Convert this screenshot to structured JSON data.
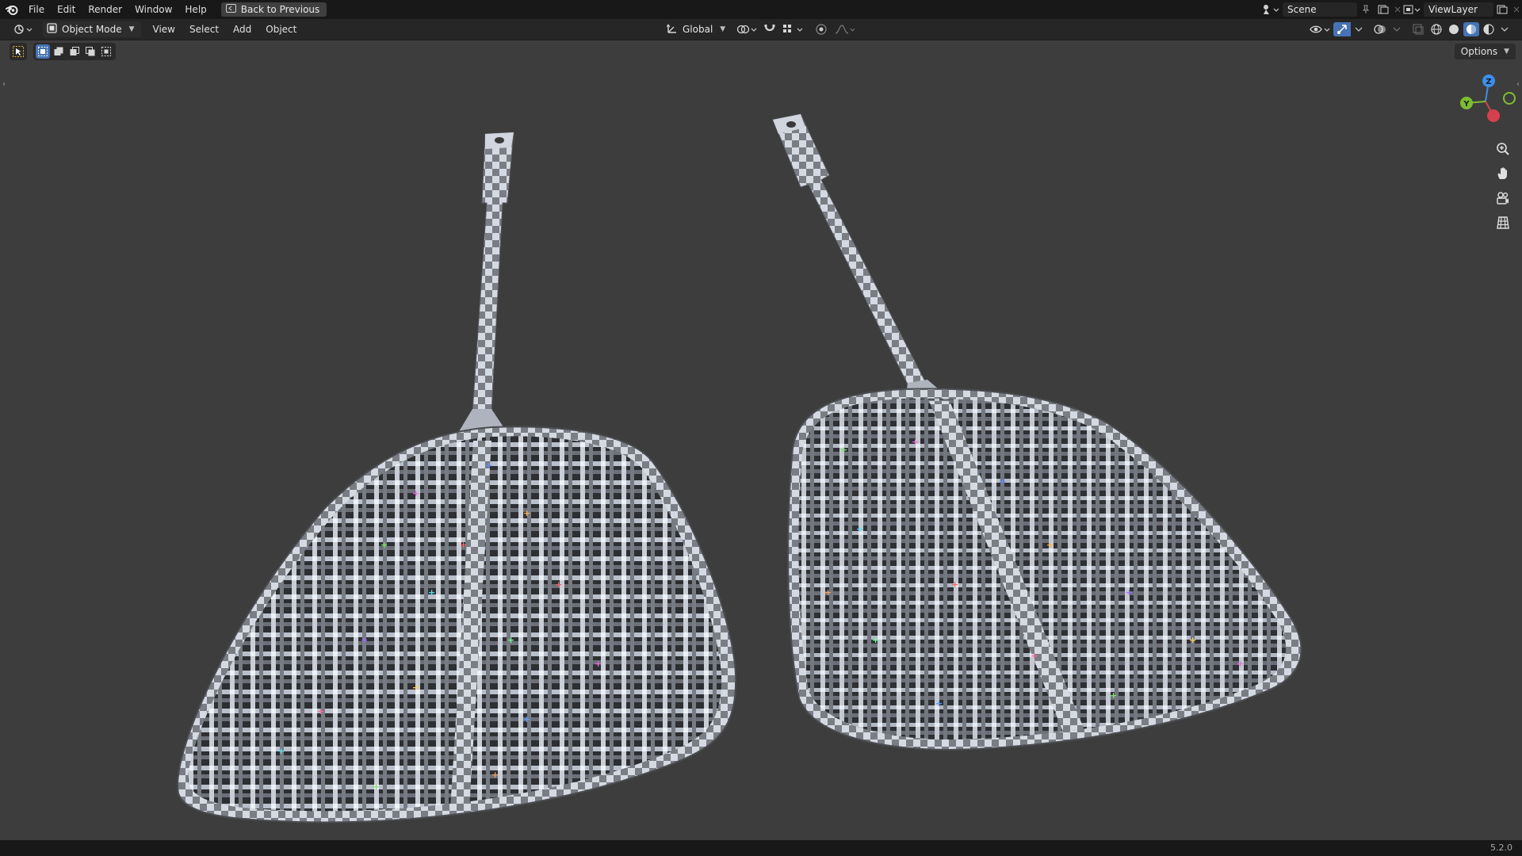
{
  "topbar": {
    "menu": [
      "File",
      "Edit",
      "Render",
      "Window",
      "Help"
    ],
    "back_label": "Back to Previous",
    "scene_label": "Scene",
    "viewlayer_label": "ViewLayer"
  },
  "header": {
    "mode_label": "Object Mode",
    "menus": [
      "View",
      "Select",
      "Add",
      "Object"
    ],
    "transform_orientation": "Global"
  },
  "tool_row": {
    "options_label": "Options"
  },
  "gizmo": {
    "z_label": "Z",
    "y_label": "Y",
    "x_color": "#d6404e",
    "y_color": "#7ebd2f",
    "z_color": "#3d8fe6"
  },
  "statusbar": {
    "version": "5.2.0"
  },
  "colors": {
    "topbar_bg": "#181818",
    "header_bg": "#262626",
    "viewport_bg": "#3d3d3d",
    "accent_blue": "#4772b3"
  },
  "icons": [
    "blender-logo-icon",
    "back-icon",
    "scene-icon",
    "pin-icon",
    "new-scene-icon",
    "viewlayer-icon",
    "editor-type-icon",
    "object-mode-icon",
    "transform-orientation-icon",
    "pivot-icon",
    "snap-icon",
    "proportional-edit-icon",
    "visibility-icon",
    "gizmo-icon",
    "overlay-icon",
    "xray-icon",
    "wireframe-shading-icon",
    "solid-shading-icon",
    "material-shading-icon",
    "rendered-shading-icon",
    "zoom-icon",
    "pan-hand-icon",
    "camera-icon",
    "ortho-grid-icon"
  ]
}
